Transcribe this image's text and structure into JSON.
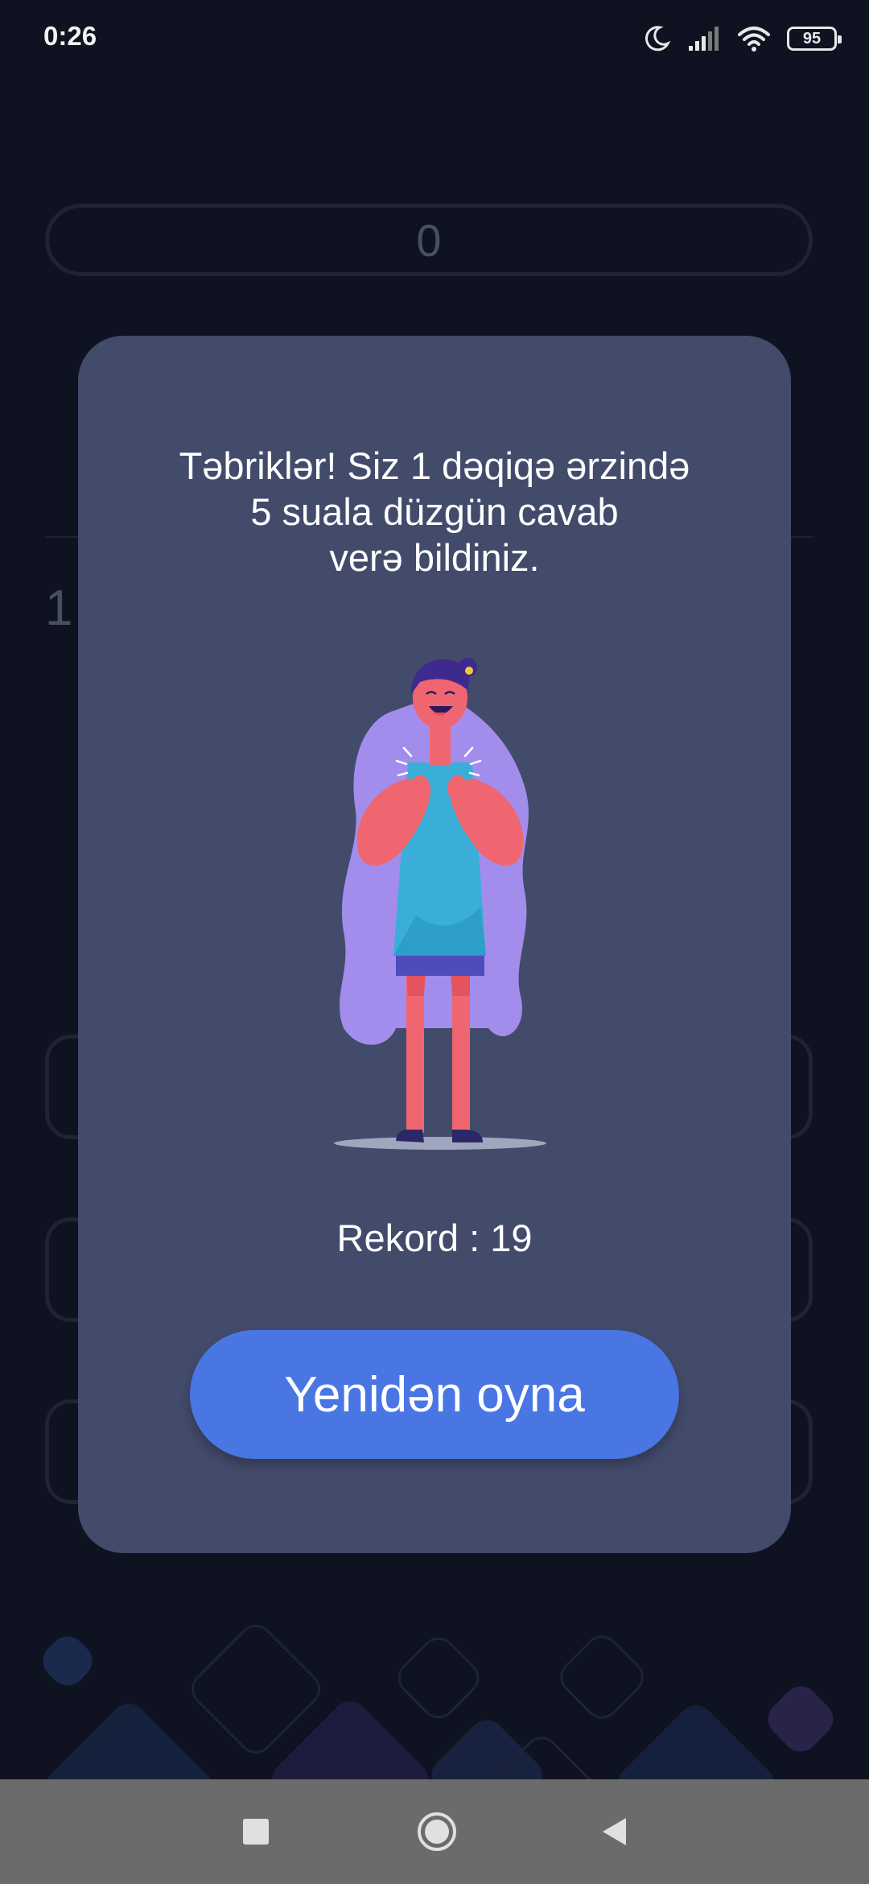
{
  "status_bar": {
    "time": "0:26",
    "battery": "95",
    "icons": [
      "moon-icon",
      "signal-icon",
      "wifi-icon",
      "battery-icon"
    ]
  },
  "game_background": {
    "score": "0",
    "question_number": "1"
  },
  "result_dialog": {
    "message_lines": [
      "Təbriklər! Siz 1 dəqiqə ərzində",
      "5 suala düzgün cavab",
      "verə bildiniz."
    ],
    "record_label": "Rekord",
    "record_separator": " : ",
    "record_value": "19",
    "replay_button": "Yenidən oyna",
    "illustration": "happy-girl-illustration"
  },
  "nav_bar": {
    "buttons": [
      "recent-apps-button",
      "home-button",
      "back-button"
    ]
  },
  "colors": {
    "background": "#0f1220",
    "dialog": "#434b6b",
    "button": "#4a76e4",
    "nav_bar": "#6b6b6b"
  }
}
